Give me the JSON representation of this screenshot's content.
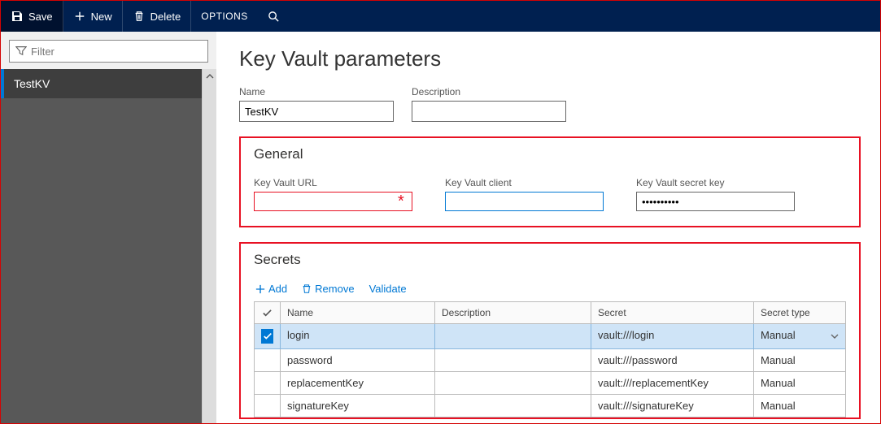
{
  "toolbar": {
    "save": "Save",
    "new": "New",
    "delete": "Delete",
    "options": "OPTIONS"
  },
  "sidebar": {
    "filter_placeholder": "Filter",
    "items": [
      {
        "label": "TestKV"
      }
    ]
  },
  "page": {
    "title": "Key Vault parameters",
    "name_label": "Name",
    "name_value": "TestKV",
    "description_label": "Description",
    "description_value": ""
  },
  "general": {
    "title": "General",
    "url_label": "Key Vault URL",
    "url_value": "",
    "client_label": "Key Vault client",
    "client_value": "",
    "secret_label": "Key Vault secret key",
    "secret_value": "••••••••••"
  },
  "secrets": {
    "title": "Secrets",
    "add": "Add",
    "remove": "Remove",
    "validate": "Validate",
    "columns": {
      "name": "Name",
      "description": "Description",
      "secret": "Secret",
      "type": "Secret type"
    },
    "rows": [
      {
        "name": "login",
        "description": "",
        "secret": "vault:///login",
        "type": "Manual",
        "selected": true
      },
      {
        "name": "password",
        "description": "",
        "secret": "vault:///password",
        "type": "Manual",
        "selected": false
      },
      {
        "name": "replacementKey",
        "description": "",
        "secret": "vault:///replacementKey",
        "type": "Manual",
        "selected": false
      },
      {
        "name": "signatureKey",
        "description": "",
        "secret": "vault:///signatureKey",
        "type": "Manual",
        "selected": false
      }
    ]
  }
}
